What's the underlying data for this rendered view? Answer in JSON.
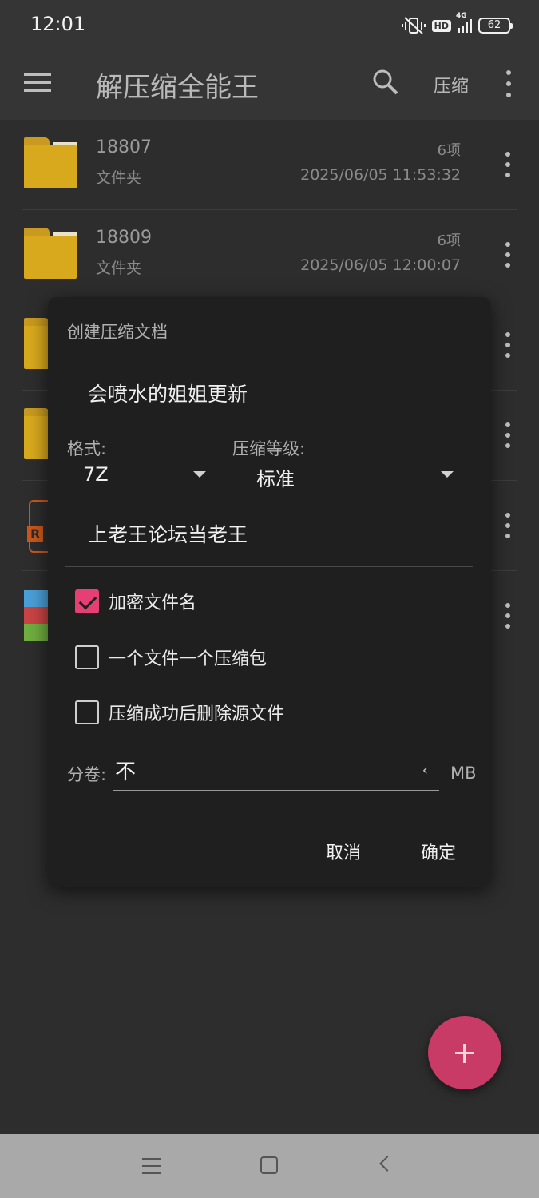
{
  "status": {
    "time": "12:01",
    "network": "4G",
    "hd": "HD",
    "battery": "62"
  },
  "appbar": {
    "title": "解压缩全能王",
    "compress_label": "压缩"
  },
  "files": [
    {
      "name": "18807",
      "type": "文件夹",
      "count": "6项",
      "date": "2025/06/05 11:53:32"
    },
    {
      "name": "18809",
      "type": "文件夹",
      "count": "6项",
      "date": "2025/06/05 12:00:07"
    }
  ],
  "dialog": {
    "title": "创建压缩文档",
    "archive_name": "会喷水的姐姐更新",
    "format_label": "格式:",
    "format_value": "7Z",
    "level_label": "压缩等级:",
    "level_value": "标准",
    "password": "上老王论坛当老王",
    "options": [
      {
        "label": "加密文件名",
        "checked": true
      },
      {
        "label": "一个文件一个压缩包",
        "checked": false
      },
      {
        "label": "压缩成功后删除源文件",
        "checked": false
      }
    ],
    "split_label": "分卷:",
    "split_value": "不",
    "split_unit": "MB",
    "cancel": "取消",
    "confirm": "确定"
  },
  "colors": {
    "accent": "#e63f73",
    "fab": "#c83b67",
    "folder": "#d9a91d"
  }
}
